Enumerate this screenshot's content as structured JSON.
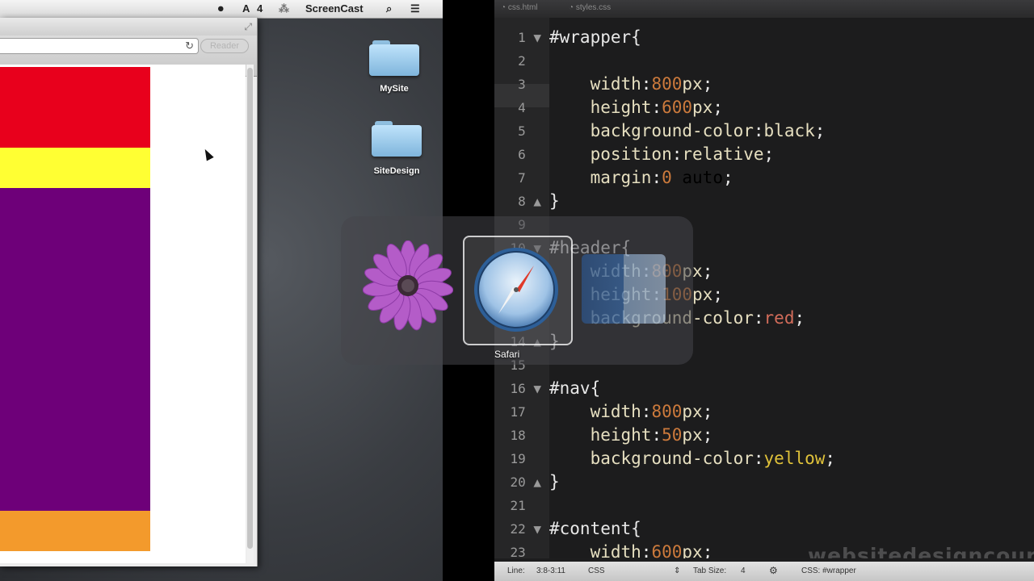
{
  "menubar": {
    "badge_count": "4",
    "app_label": "ScreenCast"
  },
  "browser": {
    "reader_label": "Reader",
    "page_blocks": [
      {
        "name": "header",
        "color": "#e8001c"
      },
      {
        "name": "nav",
        "color": "#ffff33"
      },
      {
        "name": "content",
        "color": "#6e0079"
      },
      {
        "name": "footer",
        "color": "#f39a2c"
      }
    ]
  },
  "desktop": {
    "folders": [
      "MySite",
      "SiteDesign"
    ],
    "app_switcher": {
      "apps": [
        "daisy-app-icon",
        "safari-icon",
        "finder-icon"
      ],
      "selected_label": "Safari"
    }
  },
  "editor": {
    "tabs": [
      "css.html",
      "styles.css"
    ],
    "current_line": "3",
    "lines": [
      {
        "n": "1",
        "fold": "▼",
        "text": "#wrapper{"
      },
      {
        "n": "2",
        "fold": "",
        "text": ""
      },
      {
        "n": "3",
        "fold": "",
        "text": "    width:800px;"
      },
      {
        "n": "4",
        "fold": "",
        "text": "    height:600px;"
      },
      {
        "n": "5",
        "fold": "",
        "text": "    background-color:black;"
      },
      {
        "n": "6",
        "fold": "",
        "text": "    position:relative;"
      },
      {
        "n": "7",
        "fold": "",
        "text": "    margin:0 auto;"
      },
      {
        "n": "8",
        "fold": "▲",
        "text": "}"
      },
      {
        "n": "9",
        "fold": "",
        "text": ""
      },
      {
        "n": "10",
        "fold": "▼",
        "text": "#header{"
      },
      {
        "n": "11",
        "fold": "",
        "text": "    width:800px;"
      },
      {
        "n": "12",
        "fold": "",
        "text": "    height:100px;"
      },
      {
        "n": "13",
        "fold": "",
        "text": "    background-color:red;"
      },
      {
        "n": "14",
        "fold": "▲",
        "text": "}"
      },
      {
        "n": "15",
        "fold": "",
        "text": ""
      },
      {
        "n": "16",
        "fold": "▼",
        "text": "#nav{"
      },
      {
        "n": "17",
        "fold": "",
        "text": "    width:800px;"
      },
      {
        "n": "18",
        "fold": "",
        "text": "    height:50px;"
      },
      {
        "n": "19",
        "fold": "",
        "text": "    background-color:yellow;"
      },
      {
        "n": "20",
        "fold": "▲",
        "text": "}"
      },
      {
        "n": "21",
        "fold": "",
        "text": ""
      },
      {
        "n": "22",
        "fold": "▼",
        "text": "#content{"
      },
      {
        "n": "23",
        "fold": "",
        "text": "    width:600px;"
      }
    ],
    "watermark": "websitedesigncourse.net",
    "status": {
      "line_label": "Line:",
      "line_value": "3:8-3:11",
      "language": "CSS",
      "tab_size_label": "Tab Size:",
      "tab_size_value": "4",
      "symbol": "CSS: #wrapper"
    }
  }
}
